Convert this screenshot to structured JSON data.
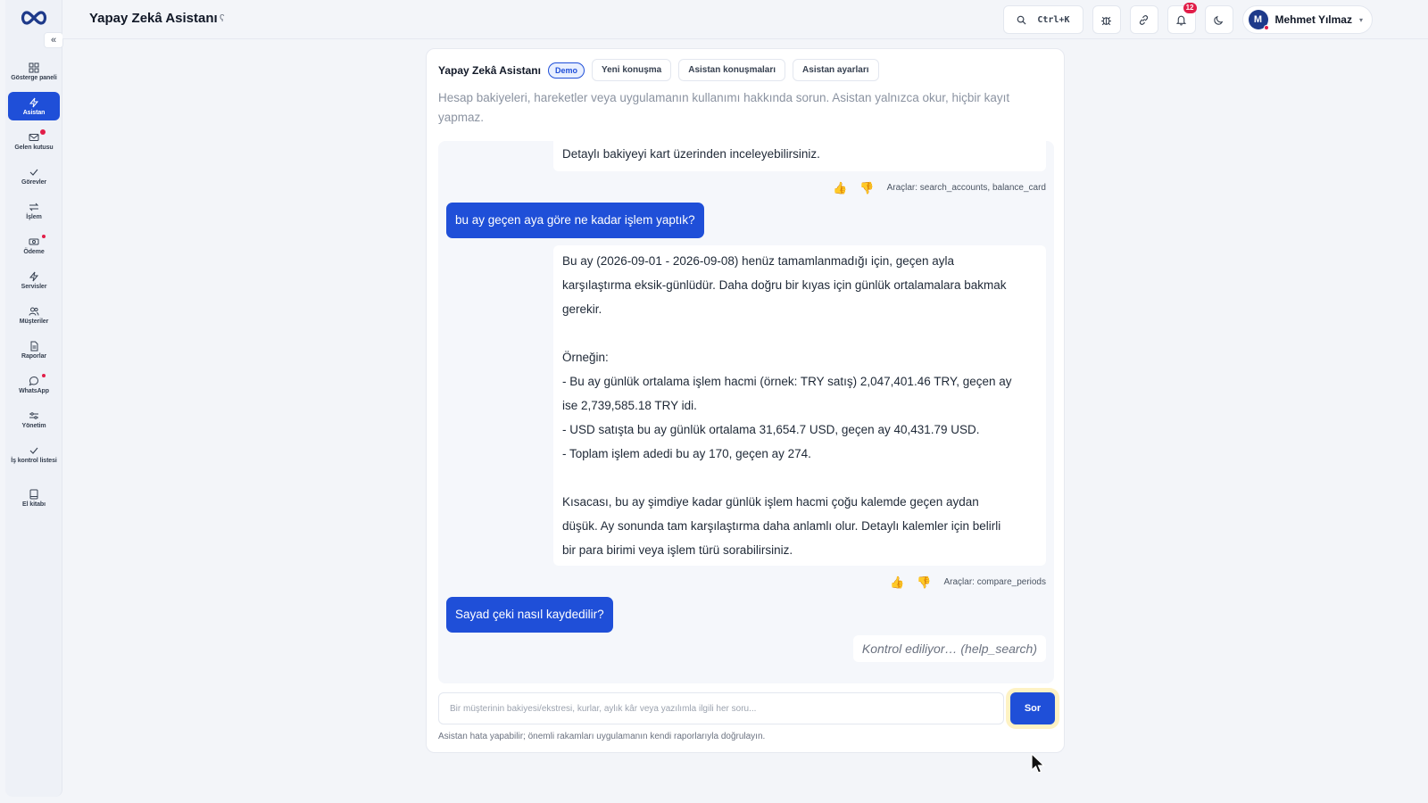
{
  "app": {
    "title": "Yapay Zekâ Asistanı",
    "title_mark": "ʕ"
  },
  "sidebar": {
    "collapse_label": "«",
    "items": [
      {
        "label": "Gösterge paneli",
        "icon": "grid-icon",
        "active": false
      },
      {
        "label": "Asistan",
        "icon": "bolt-icon",
        "active": true
      },
      {
        "label": "Gelen kutusu",
        "icon": "mail-icon",
        "active": false
      },
      {
        "label": "Görevler",
        "icon": "check-icon",
        "active": false
      },
      {
        "label": "İşlem",
        "icon": "swap-icon",
        "active": false
      },
      {
        "label": "Ödeme",
        "icon": "cash-icon",
        "active": false
      },
      {
        "label": "Servisler",
        "icon": "bolt-icon",
        "active": false
      },
      {
        "label": "Müşteriler",
        "icon": "users-icon",
        "active": false
      },
      {
        "label": "Raporlar",
        "icon": "file-icon",
        "active": false
      },
      {
        "label": "WhatsApp",
        "icon": "chat-icon",
        "active": false
      },
      {
        "label": "Yönetim",
        "icon": "sliders-icon",
        "active": false
      },
      {
        "label": "İş kontrol listesi",
        "icon": "check-icon",
        "active": false
      },
      {
        "label": "El kitabı",
        "icon": "book-icon",
        "active": false
      }
    ]
  },
  "topbar": {
    "search_shortcut": "Ctrl+K",
    "notification_count": "12",
    "user_initial": "M",
    "user_name": "Mehmet Yılmaz",
    "caret": "▾"
  },
  "assistant": {
    "title": "Yapay Zekâ Asistanı",
    "badge": "Demo",
    "buttons": {
      "new_chat": "Yeni konuşma",
      "conversations": "Asistan konuşmaları",
      "settings": "Asistan ayarları"
    },
    "description": "Hesap bakiyeleri, hareketler veya uygulamanın kullanımı hakkında sorun. Asistan yalnızca okur, hiçbir kayıt yapmaz.",
    "messages": {
      "bot1_line": "Detaylı bakiyeyi kart üzerinden inceleyebilirsiniz.",
      "tools1": "Araçlar: search_accounts, balance_card",
      "user1": "bu ay geçen aya göre ne kadar işlem yaptık?",
      "bot2_lines": [
        "Bu ay (2026-09-01 - 2026-09-08) henüz tamamlanmadığı için, geçen ayla",
        "karşılaştırma eksik-günlüdür. Daha doğru bir kıyas için günlük ortalamalara bakmak",
        "gerekir.",
        "",
        "Örneğin:",
        "- Bu ay günlük ortalama işlem hacmi (örnek: TRY satış) 2,047,401.46 TRY, geçen ay",
        "ise 2,739,585.18 TRY idi.",
        "- USD satışta bu ay günlük ortalama 31,654.7 USD, geçen ay 40,431.79 USD.",
        "- Toplam işlem adedi bu ay 170, geçen ay 274.",
        "",
        "Kısacası, bu ay şimdiye kadar günlük işlem hacmi çoğu kalemde geçen aydan",
        "düşük. Ay sonunda tam karşılaştırma daha anlamlı olur. Detaylı kalemler için belirli",
        "bir para birimi veya işlem türü sorabilirsiniz."
      ],
      "tools2": "Araçlar: compare_periods",
      "user2": "Sayad çeki nasıl kaydedilir?",
      "checking": "Kontrol ediliyor… (help_search)"
    },
    "thumb_up": "👍",
    "thumb_down": "👎",
    "input_placeholder": "Bir müşterinin bakiyesi/ekstresi, kurlar, aylık kâr veya yazılımla ilgili her soru...",
    "send_label": "Sor",
    "disclaimer": "Asistan hata yapabilir; önemli rakamları uygulamanın kendi raporlarıyla doğrulayın."
  },
  "colors": {
    "accent": "#1f4fd8",
    "alert": "#e11d48",
    "background": "#f3f5f9"
  }
}
